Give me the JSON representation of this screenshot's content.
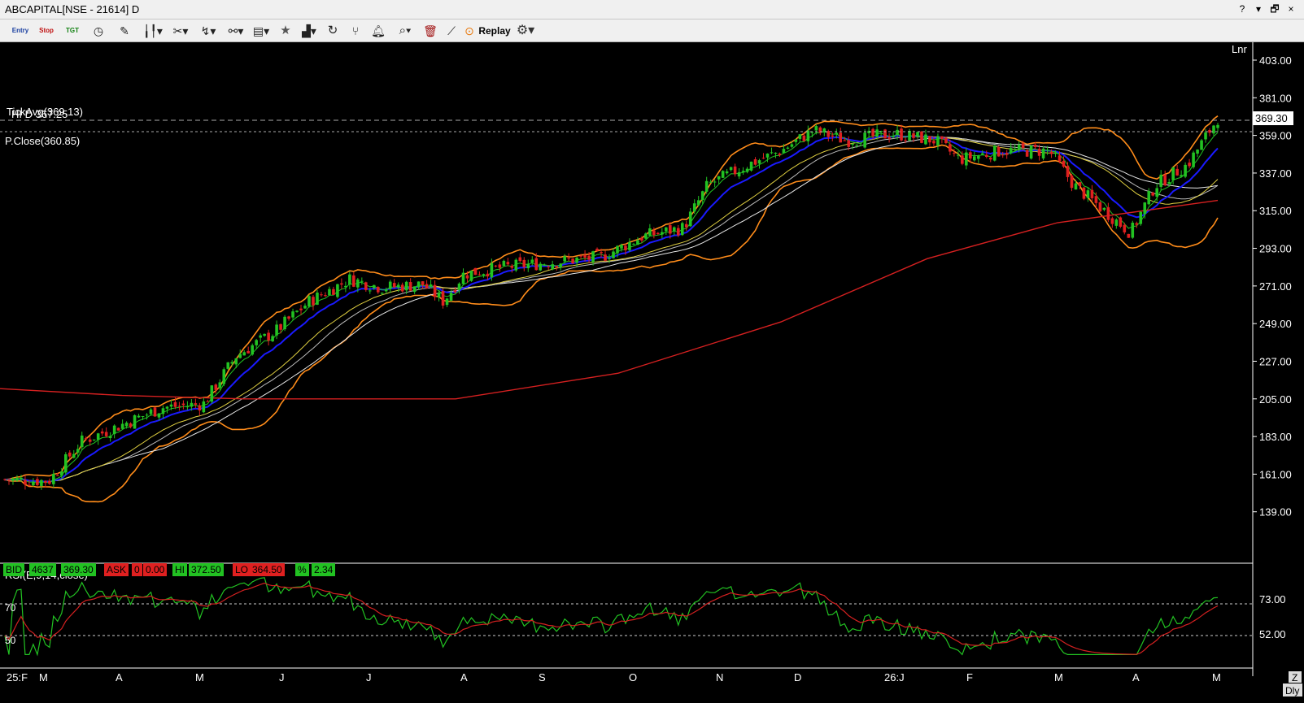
{
  "window": {
    "title": "ABCAPITAL[NSE - 21614] D",
    "controls": [
      "?",
      "▾",
      "🗗",
      "×"
    ]
  },
  "toolbar": {
    "entry_label": "Entry",
    "stop_label": "Stop",
    "tgt_label": "TGT",
    "replay_label": "Replay",
    "icons": [
      "clock-icon",
      "pen-icon",
      "candle-type-icon",
      "scissors-icon",
      "draw-icon",
      "link-icon",
      "book-icon",
      "star-icon",
      "indicator-icon",
      "refresh-icon",
      "fork-icon",
      "alert-icon",
      "zoom-icon",
      "delete-icon",
      "compare-icon",
      "replay-icon",
      "settings-icon"
    ]
  },
  "chart": {
    "mode_label": "Lnr",
    "tick_avg_label": "TickAvg(369.13)",
    "hi_d_label": "HI D 367.25",
    "prev_close_label": "P.Close(360.85)",
    "last_price_label": "369.30",
    "y_axis": [
      "403.00",
      "381.00",
      "359.00",
      "337.00",
      "315.00",
      "293.00",
      "271.00",
      "249.00",
      "227.00",
      "205.00",
      "183.00",
      "161.00",
      "139.00"
    ],
    "x_axis": [
      "25:F",
      "M",
      "A",
      "M",
      "J",
      "J",
      "A",
      "S",
      "O",
      "N",
      "D",
      "26:J",
      "F",
      "M",
      "A",
      "M"
    ],
    "colors": {
      "up": "#22c222",
      "down": "#e02020",
      "bollinger": "#ff8c1a",
      "ema_blue": "#1a1aff",
      "sma_red": "#d42020",
      "ma_yellow": "#e0d040",
      "ma_white": "#e8e8e8",
      "ma_green": "#22c222"
    }
  },
  "quote": {
    "bid_label": "BID",
    "bid_qty": "4637",
    "bid_price": "369.30",
    "ask_label": "ASK",
    "ask_qty": "0",
    "ask_price": "0.00",
    "hi_label": "HI",
    "hi_price": "372.50",
    "lo_label": "LO",
    "lo_price": "364.50",
    "pct_label": "%",
    "pct_value": "2.34"
  },
  "rsi": {
    "title": "RSI(E,9,14,close)",
    "level_70": "70",
    "level_50": "50",
    "y_axis": [
      "73.00",
      "52.00"
    ]
  },
  "corner": {
    "z_label": "Z",
    "period_label": "Dly"
  }
}
